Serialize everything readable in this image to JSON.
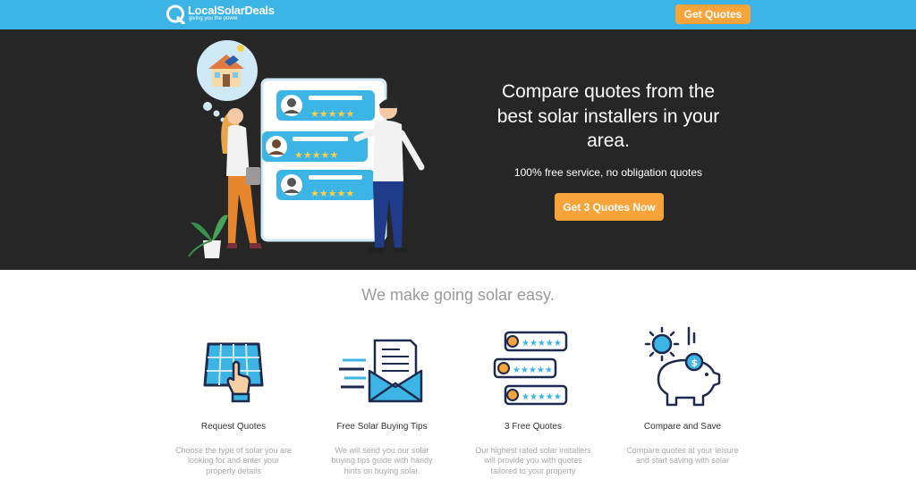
{
  "header": {
    "logo_name": "LocalSolarDeals",
    "logo_tagline": "giving you the power",
    "cta_label": "Get Quotes"
  },
  "hero": {
    "title": "Compare quotes from the best solar installers in your area.",
    "subtitle": "100% free service, no obligation quotes",
    "cta_label": "Get 3 Quotes Now",
    "review_stars": [
      5,
      5,
      5
    ]
  },
  "features": {
    "heading": "We make going solar easy.",
    "items": [
      {
        "title": "Request Quotes",
        "description": "Choose the type of solar you are looking for and enter your property details",
        "icon": "solar-panel-hand-icon"
      },
      {
        "title": "Free Solar Buying Tips",
        "description": "We will send you our solar buying tips guide with handy hints on buying solar.",
        "icon": "envelope-letter-icon"
      },
      {
        "title": "3 Free Quotes",
        "description": "Our highest rated solar installers will provide you with quotes tailored to your property",
        "icon": "reviews-icon"
      },
      {
        "title": "Compare and Save",
        "description": "Compare quotes at your leisure and start saving with solar",
        "icon": "piggy-bank-sun-icon"
      }
    ]
  },
  "colors": {
    "header_bg": "#3cb4e5",
    "hero_bg": "#262626",
    "accent": "#f9a43a"
  }
}
